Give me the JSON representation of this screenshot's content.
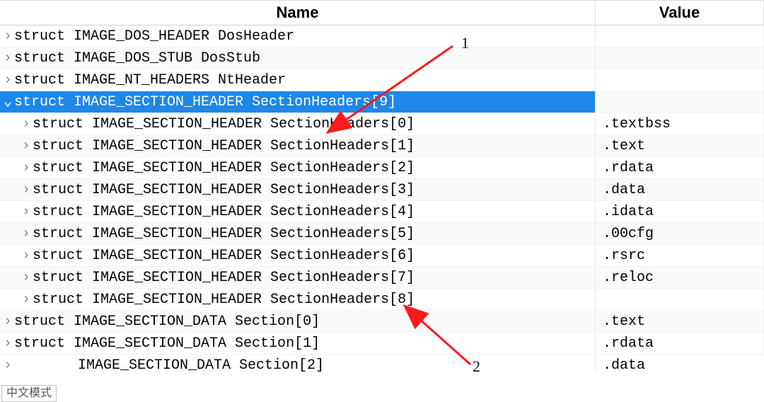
{
  "columns": {
    "name": "Name",
    "value": "Value"
  },
  "rows": [
    {
      "expanded": null,
      "indent": 0,
      "name": "struct IMAGE_DOS_HEADER DosHeader",
      "value": "",
      "selected": false
    },
    {
      "expanded": null,
      "indent": 0,
      "name": "struct IMAGE_DOS_STUB DosStub",
      "value": "",
      "selected": false
    },
    {
      "expanded": null,
      "indent": 0,
      "name": "struct IMAGE_NT_HEADERS NtHeader",
      "value": "",
      "selected": false
    },
    {
      "expanded": true,
      "indent": 0,
      "name": "struct IMAGE_SECTION_HEADER SectionHeaders[9]",
      "value": "",
      "selected": true
    },
    {
      "expanded": null,
      "indent": 1,
      "name": "struct IMAGE_SECTION_HEADER SectionHeaders[0]",
      "value": ".textbss",
      "selected": false
    },
    {
      "expanded": null,
      "indent": 1,
      "name": "struct IMAGE_SECTION_HEADER SectionHeaders[1]",
      "value": ".text",
      "selected": false
    },
    {
      "expanded": null,
      "indent": 1,
      "name": "struct IMAGE_SECTION_HEADER SectionHeaders[2]",
      "value": ".rdata",
      "selected": false
    },
    {
      "expanded": null,
      "indent": 1,
      "name": "struct IMAGE_SECTION_HEADER SectionHeaders[3]",
      "value": ".data",
      "selected": false
    },
    {
      "expanded": null,
      "indent": 1,
      "name": "struct IMAGE_SECTION_HEADER SectionHeaders[4]",
      "value": ".idata",
      "selected": false
    },
    {
      "expanded": null,
      "indent": 1,
      "name": "struct IMAGE_SECTION_HEADER SectionHeaders[5]",
      "value": ".00cfg",
      "selected": false
    },
    {
      "expanded": null,
      "indent": 1,
      "name": "struct IMAGE_SECTION_HEADER SectionHeaders[6]",
      "value": ".rsrc",
      "selected": false
    },
    {
      "expanded": null,
      "indent": 1,
      "name": "struct IMAGE_SECTION_HEADER SectionHeaders[7]",
      "value": ".reloc",
      "selected": false
    },
    {
      "expanded": null,
      "indent": 1,
      "name": "struct IMAGE_SECTION_HEADER SectionHeaders[8]",
      "value": "",
      "selected": false
    },
    {
      "expanded": null,
      "indent": 0,
      "name": "struct IMAGE_SECTION_DATA Section[0]",
      "value": ".text",
      "selected": false
    },
    {
      "expanded": null,
      "indent": 0,
      "name": "struct IMAGE_SECTION_DATA Section[1]",
      "value": ".rdata",
      "selected": false
    }
  ],
  "partial_row": {
    "expanded": null,
    "indent": 0,
    "name": "IMAGE_SECTION_DATA Section[2]",
    "value": ".data"
  },
  "badge": "中文模式",
  "annotations": {
    "label1": "1",
    "label2": "2"
  },
  "icons": {
    "collapsed": "›",
    "expanded": "⌄"
  }
}
